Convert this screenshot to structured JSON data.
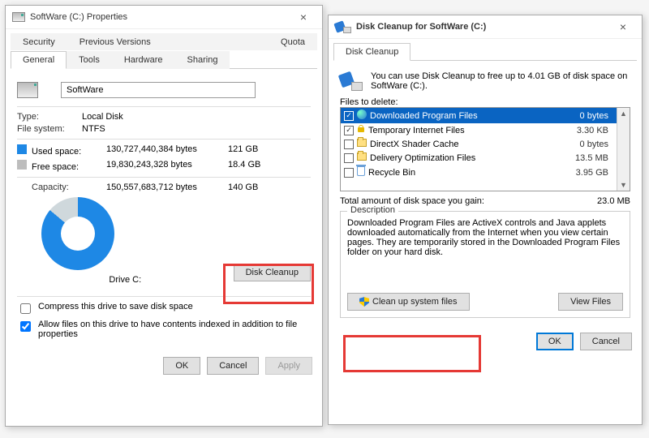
{
  "props": {
    "title": "SoftWare (C:) Properties",
    "tabs_row1": [
      "Security",
      "Previous Versions",
      "Quota"
    ],
    "tabs_row2": [
      "General",
      "Tools",
      "Hardware",
      "Sharing"
    ],
    "active_tab": "General",
    "drive_name": "SoftWare",
    "type_label": "Type:",
    "type_value": "Local Disk",
    "fs_label": "File system:",
    "fs_value": "NTFS",
    "used_label": "Used space:",
    "used_bytes": "130,727,440,384 bytes",
    "used_h": "121 GB",
    "free_label": "Free space:",
    "free_bytes": "19,830,243,328 bytes",
    "free_h": "18.4 GB",
    "cap_label": "Capacity:",
    "cap_bytes": "150,557,683,712 bytes",
    "cap_h": "140 GB",
    "drive_caption": "Drive C:",
    "disk_cleanup_btn": "Disk Cleanup",
    "compress": "Compress this drive to save disk space",
    "index": "Allow files on this drive to have contents indexed in addition to file properties",
    "ok": "OK",
    "cancel": "Cancel",
    "apply": "Apply"
  },
  "cleanup": {
    "title": "Disk Cleanup for SoftWare (C:)",
    "tab": "Disk Cleanup",
    "intro": "You can use Disk Cleanup to free up to 4.01 GB of disk space on SoftWare (C:).",
    "files_label": "Files to delete:",
    "files": [
      {
        "checked": true,
        "icon": "earth",
        "name": "Downloaded Program Files",
        "size": "0 bytes",
        "selected": true
      },
      {
        "checked": true,
        "icon": "lock",
        "name": "Temporary Internet Files",
        "size": "3.30 KB"
      },
      {
        "checked": false,
        "icon": "folder",
        "name": "DirectX Shader Cache",
        "size": "0 bytes"
      },
      {
        "checked": false,
        "icon": "folder",
        "name": "Delivery Optimization Files",
        "size": "13.5 MB"
      },
      {
        "checked": false,
        "icon": "bin",
        "name": "Recycle Bin",
        "size": "3.95 GB"
      }
    ],
    "total_label": "Total amount of disk space you gain:",
    "total_value": "23.0 MB",
    "desc_label": "Description",
    "desc_text": "Downloaded Program Files are ActiveX controls and Java applets downloaded automatically from the Internet when you view certain pages. They are temporarily stored in the Downloaded Program Files folder on your hard disk.",
    "clean_sys": "Clean up system files",
    "view_files": "View Files",
    "ok": "OK",
    "cancel": "Cancel"
  }
}
